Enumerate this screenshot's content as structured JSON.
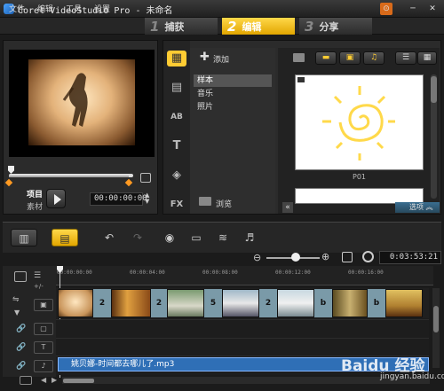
{
  "window": {
    "title": "Corel VideoStudio Pro - 未命名",
    "minimize": "─",
    "close": "✕",
    "help": "⊙"
  },
  "menu": [
    "文件",
    "编辑",
    "工具",
    "设置"
  ],
  "steps": [
    {
      "num": "1",
      "label": "捕获"
    },
    {
      "num": "2",
      "label": "编辑"
    },
    {
      "num": "3",
      "label": "分享"
    }
  ],
  "preview": {
    "project_label": "项目",
    "clip_label": "素材",
    "timecode": "00:00:00:00"
  },
  "library": {
    "add_label": "添加",
    "categories": [
      "样本",
      "音乐",
      "照片"
    ],
    "browse_label": "浏览",
    "thumbnail_label": "P01",
    "options_label": "选项",
    "side_icons": [
      "AB",
      "T",
      "FX"
    ]
  },
  "timeline": {
    "duration": "0:03:53:21",
    "ruler": [
      "00:00:00:00",
      "00:00:04:00",
      "00:00:08:00",
      "00:00:12:00",
      "00:00:16:00"
    ],
    "transitions": [
      "2",
      "2",
      "5",
      "2",
      "b",
      "b"
    ],
    "audio_clip": "姚贝娜-时间都去哪儿了.mp3"
  },
  "watermark": {
    "text": "Baidu 经验",
    "sub": "jingyan.baidu.com"
  }
}
